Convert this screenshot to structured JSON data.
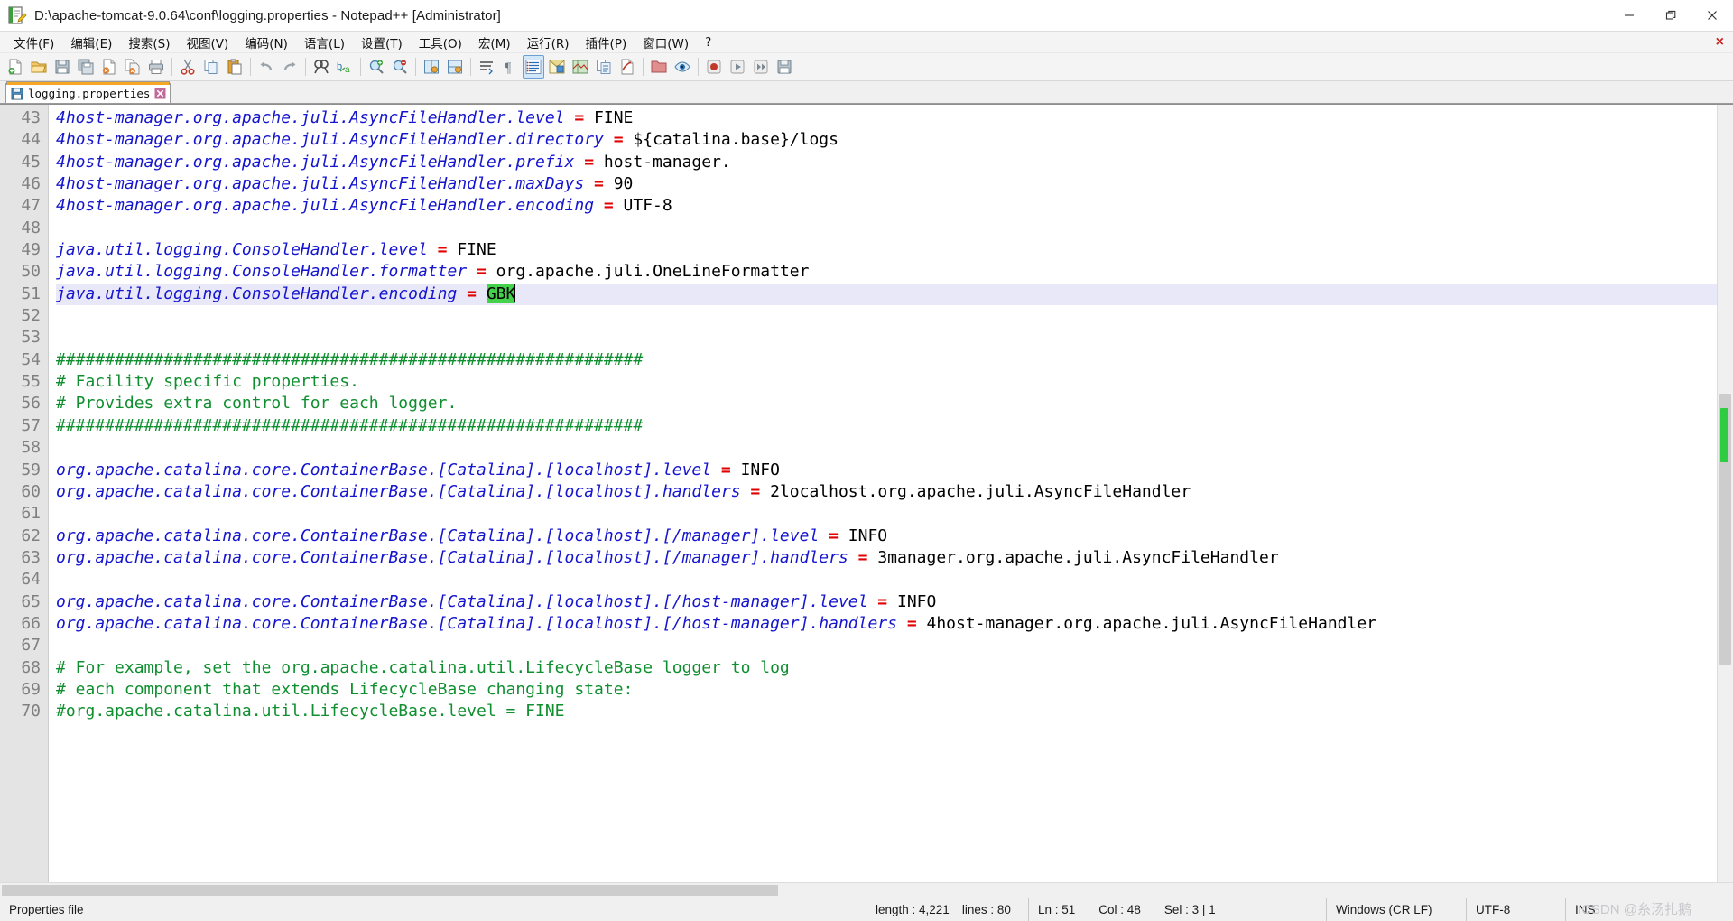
{
  "window": {
    "title": "D:\\apache-tomcat-9.0.64\\conf\\logging.properties - Notepad++ [Administrator]",
    "minimize_label": "Minimize",
    "maximize_label": "Restore",
    "close_label": "Close"
  },
  "menu": {
    "items": [
      {
        "label": "文件(F)",
        "name": "menu-file"
      },
      {
        "label": "编辑(E)",
        "name": "menu-edit"
      },
      {
        "label": "搜索(S)",
        "name": "menu-search"
      },
      {
        "label": "视图(V)",
        "name": "menu-view"
      },
      {
        "label": "编码(N)",
        "name": "menu-encoding"
      },
      {
        "label": "语言(L)",
        "name": "menu-language"
      },
      {
        "label": "设置(T)",
        "name": "menu-settings"
      },
      {
        "label": "工具(O)",
        "name": "menu-tools"
      },
      {
        "label": "宏(M)",
        "name": "menu-macro"
      },
      {
        "label": "运行(R)",
        "name": "menu-run"
      },
      {
        "label": "插件(P)",
        "name": "menu-plugins"
      },
      {
        "label": "窗口(W)",
        "name": "menu-window"
      },
      {
        "label": "?",
        "name": "menu-help"
      }
    ],
    "close_doc_label": "×"
  },
  "toolbar": {
    "buttons": [
      {
        "name": "new-file-icon",
        "title": "New"
      },
      {
        "name": "open-file-icon",
        "title": "Open"
      },
      {
        "name": "save-icon",
        "title": "Save"
      },
      {
        "name": "save-all-icon",
        "title": "Save All"
      },
      {
        "name": "close-file-icon",
        "title": "Close"
      },
      {
        "name": "close-all-icon",
        "title": "Close All"
      },
      {
        "name": "print-icon",
        "title": "Print"
      },
      {
        "name": "cut-icon",
        "title": "Cut"
      },
      {
        "name": "copy-icon",
        "title": "Copy"
      },
      {
        "name": "paste-icon",
        "title": "Paste"
      },
      {
        "name": "undo-icon",
        "title": "Undo"
      },
      {
        "name": "redo-icon",
        "title": "Redo"
      },
      {
        "name": "find-icon",
        "title": "Find"
      },
      {
        "name": "replace-icon",
        "title": "Replace"
      },
      {
        "name": "zoom-in-icon",
        "title": "Zoom In"
      },
      {
        "name": "zoom-out-icon",
        "title": "Zoom Out"
      },
      {
        "name": "sync-vertical-icon",
        "title": "Sync Vertical Scrolling"
      },
      {
        "name": "sync-horizontal-icon",
        "title": "Sync Horizontal Scrolling"
      },
      {
        "name": "word-wrap-icon",
        "title": "Word Wrap"
      },
      {
        "name": "show-all-chars-icon",
        "title": "Show All Characters"
      },
      {
        "name": "indent-guide-icon",
        "title": "Indent Guide"
      },
      {
        "name": "user-define-dialog-icon",
        "title": "User-Defined Dialog"
      },
      {
        "name": "doc-map-icon",
        "title": "Document Map"
      },
      {
        "name": "function-list-icon",
        "title": "Function List"
      },
      {
        "name": "record-macro-icon",
        "title": "Record Macro"
      },
      {
        "name": "folder-as-workspace-icon",
        "title": "Folder as Workspace"
      },
      {
        "name": "monitoring-icon",
        "title": "Monitoring"
      },
      {
        "name": "stop-record-icon",
        "title": "Stop Recording"
      },
      {
        "name": "play-macro-icon",
        "title": "Play Macro"
      },
      {
        "name": "run-multiple-macro-icon",
        "title": "Run Macro Multiple Times"
      },
      {
        "name": "save-macro-icon",
        "title": "Save Current Recorded Macro"
      }
    ]
  },
  "tab": {
    "label": "logging.properties",
    "close_glyph": "✕"
  },
  "editor": {
    "first_line_number": 43,
    "lines": [
      {
        "n": 43,
        "segments": [
          {
            "t": "key",
            "s": "4host-manager.org.apache.juli.AsyncFileHandler.level"
          },
          {
            "t": "eq",
            "s": " = "
          },
          {
            "t": "val",
            "s": "FINE"
          }
        ]
      },
      {
        "n": 44,
        "segments": [
          {
            "t": "key",
            "s": "4host-manager.org.apache.juli.AsyncFileHandler.directory"
          },
          {
            "t": "eq",
            "s": " = "
          },
          {
            "t": "val",
            "s": "${catalina.base}/logs"
          }
        ]
      },
      {
        "n": 45,
        "segments": [
          {
            "t": "key",
            "s": "4host-manager.org.apache.juli.AsyncFileHandler.prefix"
          },
          {
            "t": "eq",
            "s": " = "
          },
          {
            "t": "val",
            "s": "host-manager."
          }
        ]
      },
      {
        "n": 46,
        "segments": [
          {
            "t": "key",
            "s": "4host-manager.org.apache.juli.AsyncFileHandler.maxDays"
          },
          {
            "t": "eq",
            "s": " = "
          },
          {
            "t": "val",
            "s": "90"
          }
        ]
      },
      {
        "n": 47,
        "segments": [
          {
            "t": "key",
            "s": "4host-manager.org.apache.juli.AsyncFileHandler.encoding"
          },
          {
            "t": "eq",
            "s": " = "
          },
          {
            "t": "val",
            "s": "UTF-8"
          }
        ]
      },
      {
        "n": 48,
        "segments": []
      },
      {
        "n": 49,
        "segments": [
          {
            "t": "key",
            "s": "java.util.logging.ConsoleHandler.level"
          },
          {
            "t": "eq",
            "s": " = "
          },
          {
            "t": "val",
            "s": "FINE"
          }
        ]
      },
      {
        "n": 50,
        "segments": [
          {
            "t": "key",
            "s": "java.util.logging.ConsoleHandler.formatter"
          },
          {
            "t": "eq",
            "s": " = "
          },
          {
            "t": "val",
            "s": "org.apache.juli.OneLineFormatter"
          }
        ]
      },
      {
        "n": 51,
        "current": true,
        "segments": [
          {
            "t": "key",
            "s": "java.util.logging.ConsoleHandler.encoding"
          },
          {
            "t": "eq",
            "s": " = "
          },
          {
            "t": "sel",
            "s": "GBK"
          },
          {
            "t": "caret",
            "s": ""
          }
        ]
      },
      {
        "n": 52,
        "segments": []
      },
      {
        "n": 53,
        "segments": []
      },
      {
        "n": 54,
        "segments": [
          {
            "t": "comment",
            "s": "############################################################"
          }
        ]
      },
      {
        "n": 55,
        "segments": [
          {
            "t": "comment",
            "s": "# Facility specific properties."
          }
        ]
      },
      {
        "n": 56,
        "segments": [
          {
            "t": "comment",
            "s": "# Provides extra control for each logger."
          }
        ]
      },
      {
        "n": 57,
        "segments": [
          {
            "t": "comment",
            "s": "############################################################"
          }
        ]
      },
      {
        "n": 58,
        "segments": []
      },
      {
        "n": 59,
        "segments": [
          {
            "t": "key",
            "s": "org.apache.catalina.core.ContainerBase.[Catalina].[localhost].level"
          },
          {
            "t": "eq",
            "s": " = "
          },
          {
            "t": "val",
            "s": "INFO"
          }
        ]
      },
      {
        "n": 60,
        "segments": [
          {
            "t": "key",
            "s": "org.apache.catalina.core.ContainerBase.[Catalina].[localhost].handlers"
          },
          {
            "t": "eq",
            "s": " = "
          },
          {
            "t": "val",
            "s": "2localhost.org.apache.juli.AsyncFileHandler"
          }
        ]
      },
      {
        "n": 61,
        "segments": []
      },
      {
        "n": 62,
        "segments": [
          {
            "t": "key",
            "s": "org.apache.catalina.core.ContainerBase.[Catalina].[localhost].[/manager].level"
          },
          {
            "t": "eq",
            "s": " = "
          },
          {
            "t": "val",
            "s": "INFO"
          }
        ]
      },
      {
        "n": 63,
        "segments": [
          {
            "t": "key",
            "s": "org.apache.catalina.core.ContainerBase.[Catalina].[localhost].[/manager].handlers"
          },
          {
            "t": "eq",
            "s": " = "
          },
          {
            "t": "val",
            "s": "3manager.org.apache.juli.AsyncFileHandler"
          }
        ]
      },
      {
        "n": 64,
        "segments": []
      },
      {
        "n": 65,
        "segments": [
          {
            "t": "key",
            "s": "org.apache.catalina.core.ContainerBase.[Catalina].[localhost].[/host-manager].level"
          },
          {
            "t": "eq",
            "s": " = "
          },
          {
            "t": "val",
            "s": "INFO"
          }
        ]
      },
      {
        "n": 66,
        "segments": [
          {
            "t": "key",
            "s": "org.apache.catalina.core.ContainerBase.[Catalina].[localhost].[/host-manager].handlers"
          },
          {
            "t": "eq",
            "s": " = "
          },
          {
            "t": "val",
            "s": "4host-manager.org.apache.juli.AsyncFileHandler"
          }
        ]
      },
      {
        "n": 67,
        "segments": []
      },
      {
        "n": 68,
        "segments": [
          {
            "t": "comment",
            "s": "# For example, set the org.apache.catalina.util.LifecycleBase logger to log"
          }
        ]
      },
      {
        "n": 69,
        "segments": [
          {
            "t": "comment",
            "s": "# each component that extends LifecycleBase changing state:"
          }
        ]
      },
      {
        "n": 70,
        "segments": [
          {
            "t": "comment",
            "s": "#org.apache.catalina.util.LifecycleBase.level = FINE"
          }
        ]
      }
    ]
  },
  "statusbar": {
    "doc_type": "Properties file",
    "length_label": "length : 4,221",
    "lines_label": "lines : 80",
    "ln": "Ln : 51",
    "col": "Col : 48",
    "sel": "Sel : 3 | 1",
    "eol": "Windows (CR LF)",
    "encoding": "UTF-8",
    "insert_mode": "INS",
    "watermark": "CSDN @糸汤扎鹅"
  },
  "colors": {
    "key": "#1515cf",
    "equals": "#e00000",
    "value": "#000000",
    "comment": "#0f8f2f",
    "selection": "#44d14c",
    "current_line": "#e8e8f8",
    "tab_active": "#f5a623"
  }
}
